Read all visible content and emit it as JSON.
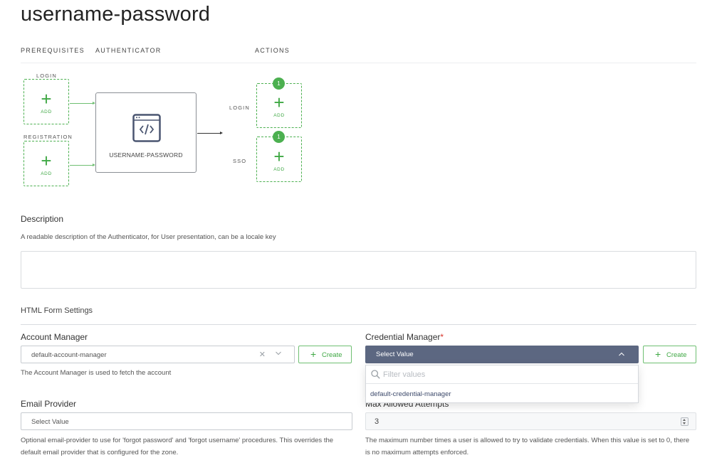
{
  "page": {
    "title": "username-password"
  },
  "flow": {
    "headers": {
      "prerequisites": "PREREQUISITES",
      "authenticator": "AUTHENTICATOR",
      "actions": "ACTIONS"
    },
    "prerequisites": [
      {
        "label": "LOGIN",
        "add_label": "ADD"
      },
      {
        "label": "REGISTRATION",
        "add_label": "ADD"
      }
    ],
    "authenticator": {
      "name": "USERNAME-PASSWORD",
      "icon": "code-window-icon"
    },
    "actions": [
      {
        "label": "LOGIN",
        "add_label": "ADD",
        "badge": "1"
      },
      {
        "label": "SSO",
        "add_label": "ADD",
        "badge": "1"
      }
    ],
    "accent_color": "#4cb050"
  },
  "description": {
    "title": "Description",
    "help": "A readable description of the Authenticator, for User presentation, can be a locale key",
    "value": ""
  },
  "html_form": {
    "title": "HTML Form Settings",
    "account_manager": {
      "label": "Account Manager",
      "value": "default-account-manager",
      "create_label": "Create",
      "help": "The Account Manager is used to fetch the account"
    },
    "credential_manager": {
      "label": "Credential Manager",
      "required_mark": "*",
      "value": "Select Value",
      "create_label": "Create",
      "filter_placeholder": "Filter values",
      "options": [
        "default-credential-manager"
      ],
      "select_color": "#5c6781"
    },
    "email_provider": {
      "label": "Email Provider",
      "value": "Select Value",
      "help_line1": "Optional email-provider to use for 'forgot password' and 'forgot username' procedures. This overrides the",
      "help_line2": "default email provider that is configured for the zone."
    },
    "max_attempts": {
      "label": "Max Allowed Attempts",
      "value": "3",
      "help_line1": "The maximum number times a user is allowed to try to validate credentials. When this value is set to 0, there",
      "help_line2": "is no maximum attempts enforced."
    }
  }
}
